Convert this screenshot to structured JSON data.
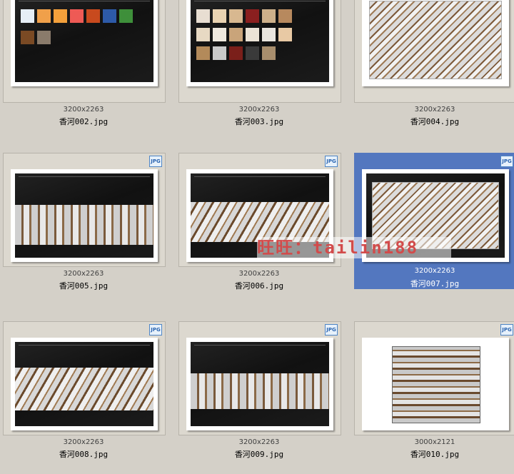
{
  "watermark": "旺旺：tailin188",
  "badge": "JPG",
  "items": [
    {
      "dims": "3200x2263",
      "name": "香河002.jpg"
    },
    {
      "dims": "3200x2263",
      "name": "香河003.jpg"
    },
    {
      "dims": "3200x2263",
      "name": "香河004.jpg"
    },
    {
      "dims": "3200x2263",
      "name": "香河005.jpg"
    },
    {
      "dims": "3200x2263",
      "name": "香河006.jpg"
    },
    {
      "dims": "3200x2263",
      "name": "香河007.jpg"
    },
    {
      "dims": "3200x2263",
      "name": "香河008.jpg"
    },
    {
      "dims": "3200x2263",
      "name": "香河009.jpg"
    },
    {
      "dims": "3000x2121",
      "name": "香河010.jpg"
    }
  ],
  "selected_item": "香河007.jpg",
  "colors": {
    "window_bg": "#d4d0c8",
    "selection": "#5377bf",
    "watermark_text": "#d24b4b"
  },
  "swatch_colors_002": [
    "#e6eef6",
    "#f0a04a",
    "#f3a03b",
    "#ee5a55",
    "#c84a1e",
    "#2d5aa8",
    "#3e8f3a",
    "#7a4a24",
    "#8a7b6b"
  ],
  "swatch_colors_003": [
    "#e8ded2",
    "#e9d3b2",
    "#d8b890",
    "#8a1f1f",
    "#cdb08a",
    "#b7895e",
    "#e7d9c3",
    "#efe9df",
    "#c9a47a",
    "#ebe3d6",
    "#e9e5de",
    "#e8c9a4",
    "#b38a5a",
    "#c9c9c9",
    "#7a1f1a",
    "#3a3a3a",
    "#a88e6d"
  ]
}
